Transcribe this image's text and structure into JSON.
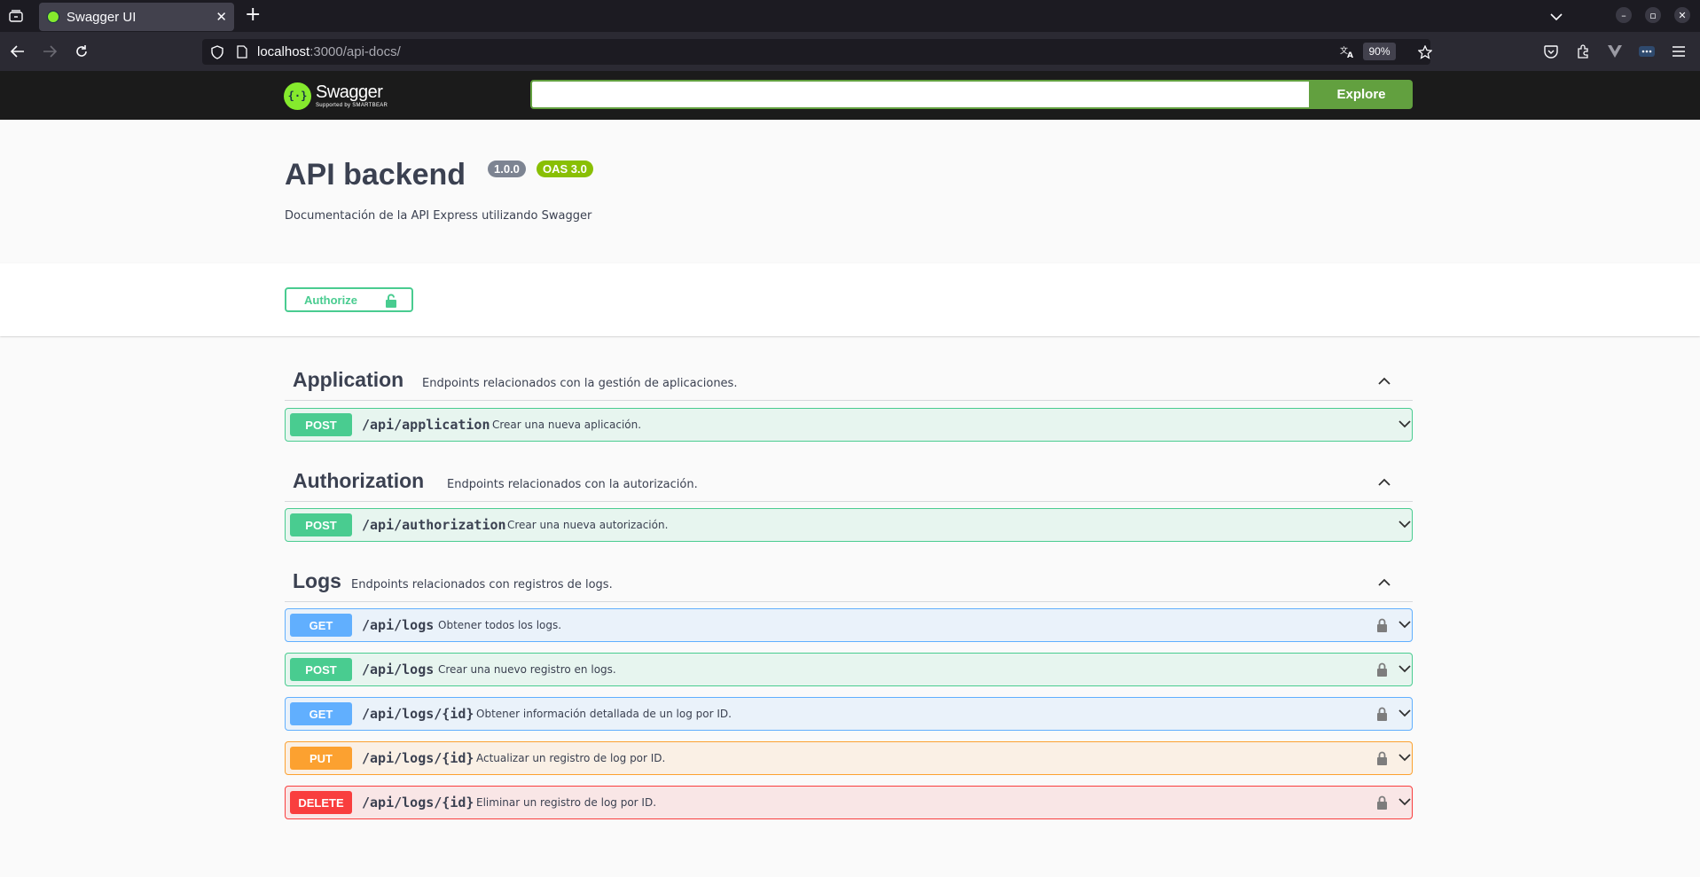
{
  "browser": {
    "tab_title": "Swagger UI",
    "url_host": "localhost",
    "url_rest": ":3000/api-docs/",
    "zoom": "90%"
  },
  "swagger": {
    "logo_title": "Swagger",
    "logo_sub": "Supported by SMARTBEAR",
    "explore_value": "",
    "explore_label": "Explore"
  },
  "info": {
    "title": "API backend",
    "version": "1.0.0",
    "oas": "OAS 3.0",
    "description": "Documentación de la API Express utilizando Swagger"
  },
  "authorize": {
    "label": "Authorize"
  },
  "tags": [
    {
      "name": "Application",
      "description": "Endpoints relacionados con la gestión de aplicaciones.",
      "operations": [
        {
          "method": "POST",
          "path": "/api/application",
          "summary": "Crear una nueva aplicación.",
          "locked": false
        }
      ]
    },
    {
      "name": "Authorization",
      "description": "Endpoints relacionados con la autorización.",
      "operations": [
        {
          "method": "POST",
          "path": "/api/authorization",
          "summary": "Crear una nueva autorización.",
          "locked": false
        }
      ]
    },
    {
      "name": "Logs",
      "description": "Endpoints relacionados con registros de logs.",
      "operations": [
        {
          "method": "GET",
          "path": "/api/logs",
          "summary": "Obtener todos los logs.",
          "locked": true
        },
        {
          "method": "POST",
          "path": "/api/logs",
          "summary": "Crear una nuevo registro en logs.",
          "locked": true
        },
        {
          "method": "GET",
          "path": "/api/logs/{id}",
          "summary": "Obtener información detallada de un log por ID.",
          "locked": true
        },
        {
          "method": "PUT",
          "path": "/api/logs/{id}",
          "summary": "Actualizar un registro de log por ID.",
          "locked": true
        },
        {
          "method": "DELETE",
          "path": "/api/logs/{id}",
          "summary": "Eliminar un registro de log por ID.",
          "locked": true
        }
      ]
    }
  ]
}
